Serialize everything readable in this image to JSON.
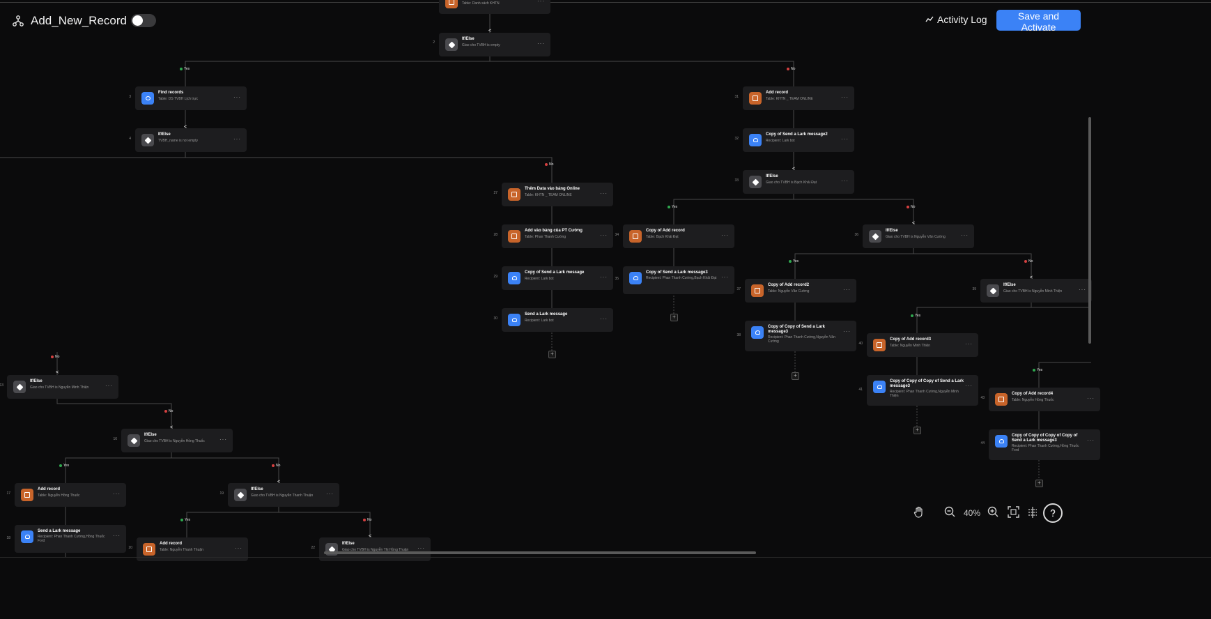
{
  "header": {
    "title": "Add_New_Record",
    "activity_label": "Activity Log",
    "save_label": "Save and Activate"
  },
  "toolbar": {
    "zoom": "40%"
  },
  "branch_labels": {
    "yes": "Yes",
    "no": "No"
  },
  "nodes": {
    "n_top": {
      "title": "",
      "sub": "Table: Danh sách KHTN"
    },
    "n2": {
      "num": "2",
      "title": "If/Else",
      "sub": "Giao cho TVBH is empty"
    },
    "n3": {
      "num": "3",
      "title": "Find records",
      "sub": "Table: DS TVBH Lịch trực"
    },
    "n4": {
      "num": "4",
      "title": "If/Else",
      "sub": "TVBH_name is not empty"
    },
    "n31": {
      "num": "31",
      "title": "Add record",
      "sub": "Table: KHTN _ TEAM ONLINE"
    },
    "n32": {
      "num": "32",
      "title": "Copy of Send a Lark message2",
      "sub": "Recipient: Lark bot"
    },
    "n33": {
      "num": "33",
      "title": "If/Else",
      "sub": "Giao cho TVBH is Bạch Khải Đạt"
    },
    "n27": {
      "num": "27",
      "title": "Thêm Data vào bảng Online",
      "sub": "Table: KHTN _ TEAM ONLINE"
    },
    "n28": {
      "num": "28",
      "title": "Add vào bảng của PT Cường",
      "sub": "Table: Phan Thanh Cường"
    },
    "n29": {
      "num": "29",
      "title": "Copy of Send a Lark message",
      "sub": "Recipient: Lark bot"
    },
    "n30": {
      "num": "30",
      "title": "Send a Lark message",
      "sub": "Recipient: Lark bot"
    },
    "n34": {
      "num": "34",
      "title": "Copy of Add record",
      "sub": "Table: Bạch Khải Đạt"
    },
    "n35": {
      "num": "35",
      "title": "Copy of Send a Lark message3",
      "sub": "Recipient: Phan Thanh Cường,Bạch Khải Đạt"
    },
    "n36": {
      "num": "36",
      "title": "If/Else",
      "sub": "Giao cho TVBH is Nguyễn Văn Cường"
    },
    "n37": {
      "num": "37",
      "title": "Copy of Add record2",
      "sub": "Table: Nguyễn Văn Cường"
    },
    "n38": {
      "num": "38",
      "title": "Copy of Copy of Send a Lark message3",
      "sub": "Recipient: Phan Thanh Cường,Nguyễn Văn Cường"
    },
    "n39": {
      "num": "39",
      "title": "If/Else",
      "sub": "Giao cho TVBH is Nguyễn Minh Thiện"
    },
    "n40": {
      "num": "40",
      "title": "Copy of Add record3",
      "sub": "Table: Nguyễn Minh Thiện"
    },
    "n41": {
      "num": "41",
      "title": "Copy of Copy of Copy of Send a Lark message3",
      "sub": "Recipient: Phan Thanh Cường,Nguyễn Minh Thiện"
    },
    "n43": {
      "num": "43",
      "title": "Copy of Add record4",
      "sub": "Table: Nguyễn Hồng Thuốc"
    },
    "n44": {
      "num": "44",
      "title": "Copy of Copy of Copy of Copy of Send a Lark message3",
      "sub": "Recipient: Phan Thanh Cường,Hồng Thuốc Ford"
    },
    "n13": {
      "num": "13",
      "title": "If/Else",
      "sub": "Giao cho TVBH is Nguyễn Minh Thiện"
    },
    "n16": {
      "num": "16",
      "title": "If/Else",
      "sub": "Giao cho TVBH is Nguyễn Hồng Thuốc"
    },
    "n17": {
      "num": "17",
      "title": "Add record",
      "sub": "Table: Nguyễn Hồng Thuốc"
    },
    "n18": {
      "num": "18",
      "title": "Send a Lark message",
      "sub": "Recipient: Phan Thanh Cường,Hồng Thuốc Ford"
    },
    "n19": {
      "num": "19",
      "title": "If/Else",
      "sub": "Giao cho TVBH is Nguyễn Thanh Thuận"
    },
    "n20": {
      "num": "20",
      "title": "Add record",
      "sub": "Table: Nguyễn Thanh Thuận"
    },
    "n22": {
      "num": "22",
      "title": "If/Else",
      "sub": "Giao cho TVBH is Nguyễn Thị Hồng Thuận"
    }
  }
}
